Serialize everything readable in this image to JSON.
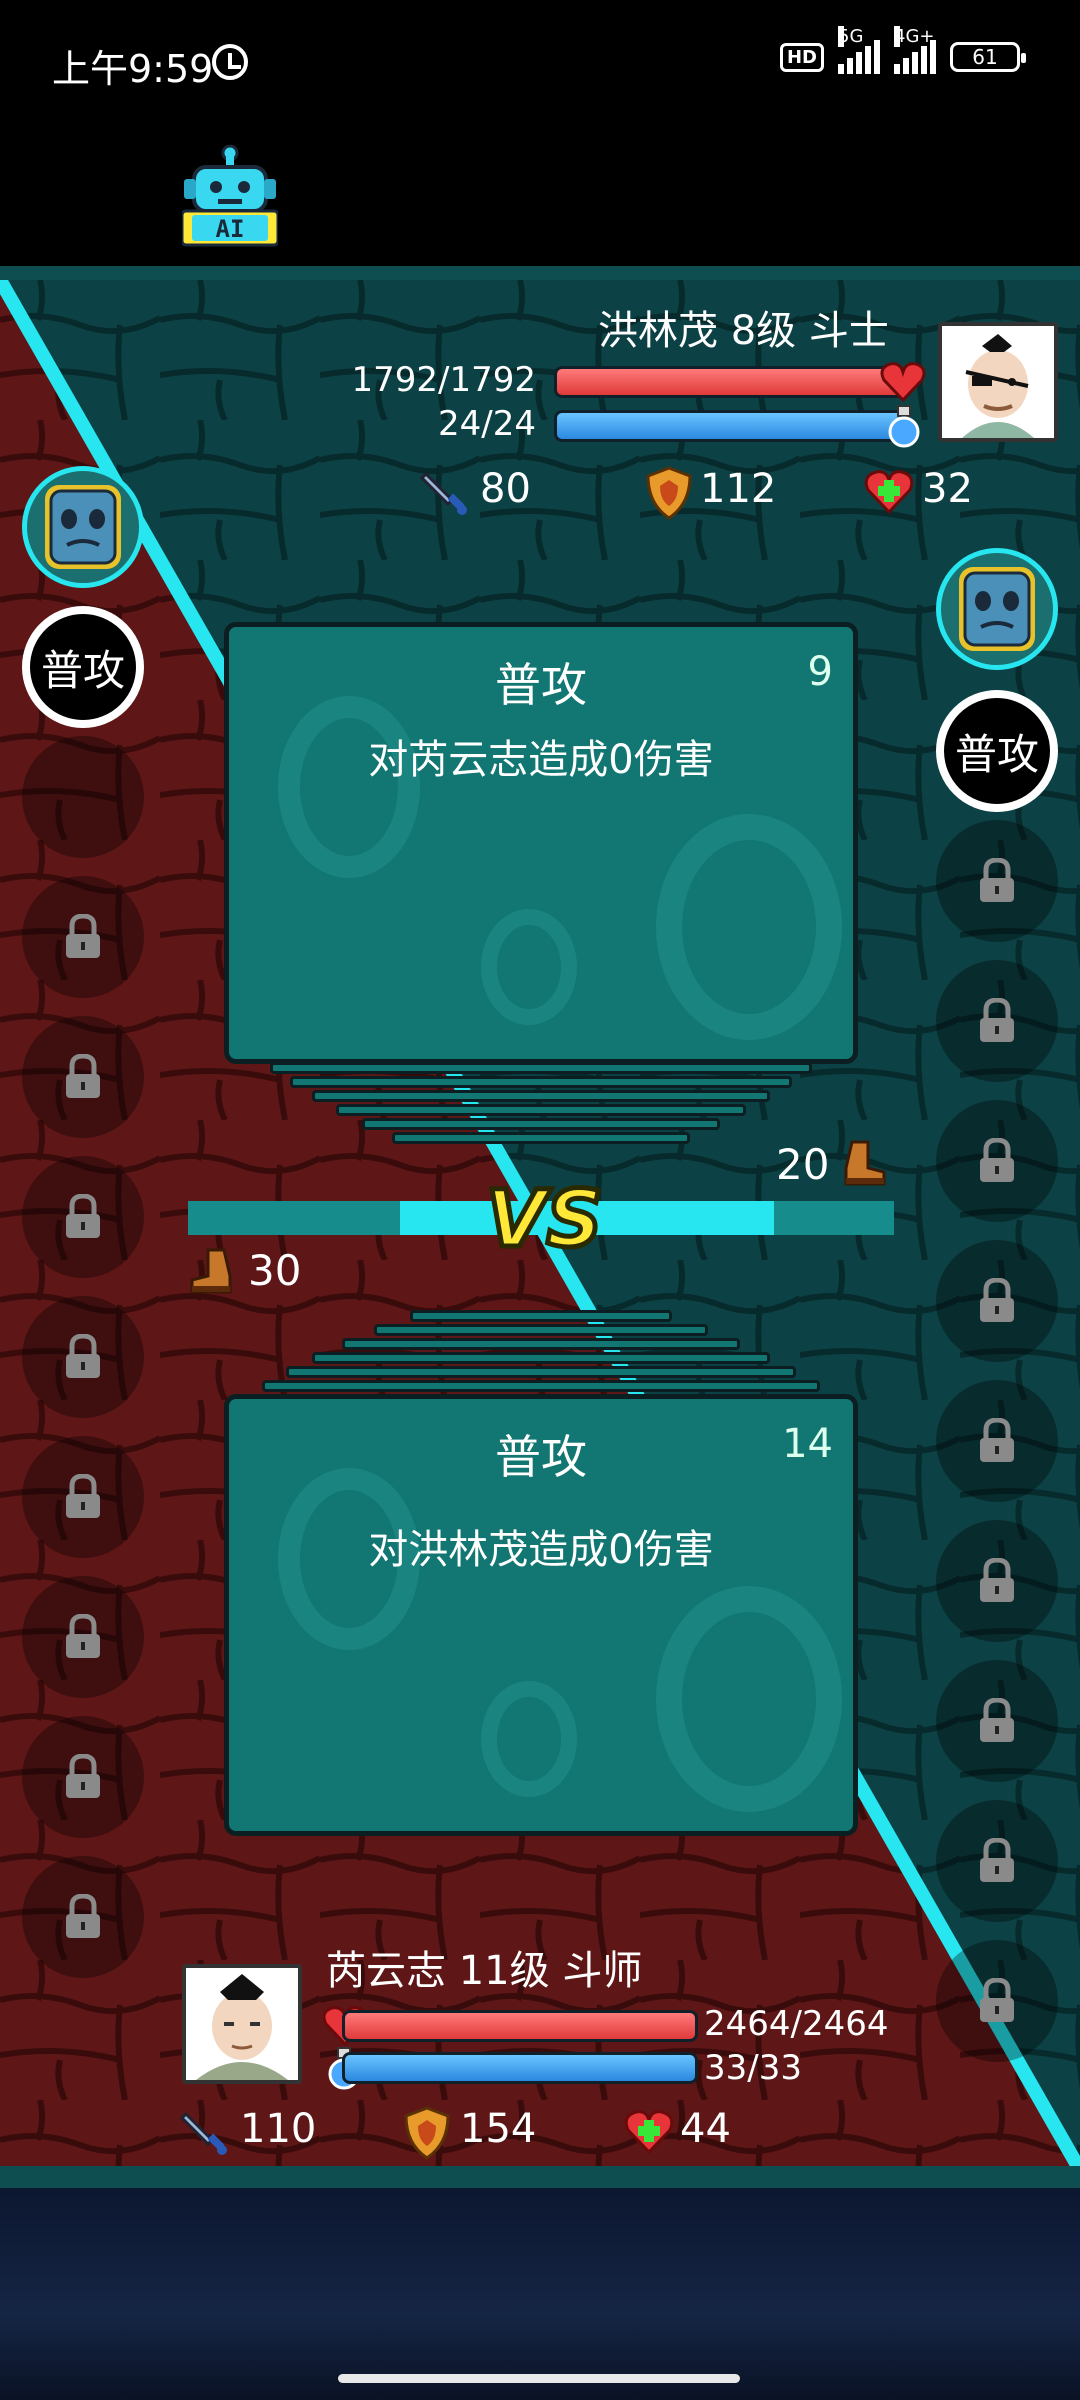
{
  "status_bar": {
    "time": "上午9:59",
    "network_1": "5G",
    "network_2": "4G+",
    "badge": "HD",
    "battery": "61"
  },
  "opponent": {
    "name_line": "洪林茂 8级 斗士",
    "hp_text": "1792/1792",
    "mp_text": "24/24",
    "hp_fraction": 1.0,
    "mp_fraction": 1.0,
    "attack": "80",
    "defense": "112",
    "heal": "32",
    "speed": "20",
    "skill_label": "普攻"
  },
  "player": {
    "name_line": "芮云志 11级 斗师",
    "hp_text": "2464/2464",
    "mp_text": "33/33",
    "hp_fraction": 1.0,
    "mp_fraction": 1.0,
    "attack": "110",
    "defense": "154",
    "heal": "44",
    "speed": "30",
    "skill_label": "普攻"
  },
  "top_card": {
    "title": "普攻",
    "cost": "9",
    "description": "对芮云志造成0伤害"
  },
  "bottom_card": {
    "title": "普攻",
    "cost": "14",
    "description": "对洪林茂造成0伤害"
  },
  "vs_label": "VS",
  "ai_label": "AI",
  "colors": {
    "player_side": "#5a1414",
    "opponent_side": "#0a3a3d",
    "divider": "#27e6f0",
    "card": "#127672",
    "hp": "#e03a3a",
    "mp": "#2a88e0",
    "vs": "#ffe838"
  },
  "icons": {
    "attack": "sword-icon",
    "defense": "shield-icon",
    "heal": "heart-plus-icon",
    "speed": "boot-icon",
    "locked_slot": "lock-icon",
    "ai": "robot-icon",
    "alarm": "alarm-icon"
  }
}
